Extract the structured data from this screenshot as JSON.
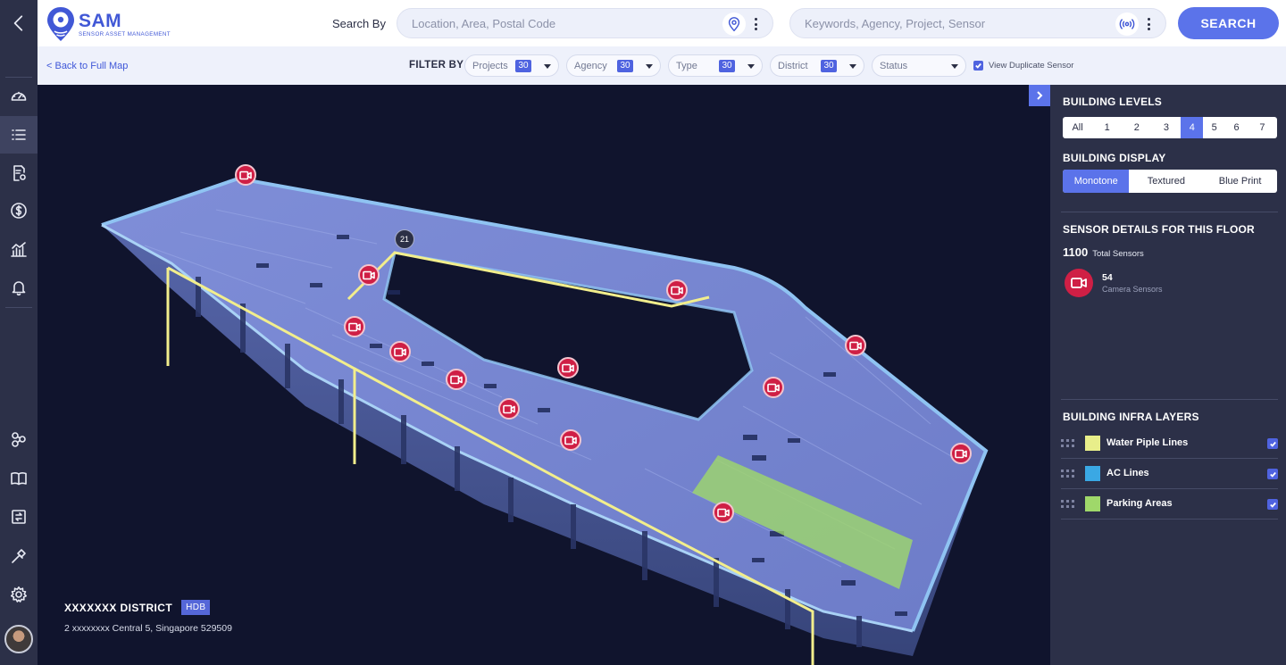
{
  "app": {
    "name": "SAM",
    "subtitle": "SENSOR ASSET MANAGEMENT"
  },
  "header": {
    "search_by_label": "Search By",
    "location_placeholder": "Location, Area, Postal Code",
    "keywords_placeholder": "Keywords, Agency, Project, Sensor",
    "search_button": "SEARCH"
  },
  "filterbar": {
    "back_link": "< Back to Full Map",
    "filter_by_label": "FILTER BY",
    "filters": [
      {
        "label": "Projects",
        "count": "30"
      },
      {
        "label": "Agency",
        "count": "30"
      },
      {
        "label": "Type",
        "count": "30"
      },
      {
        "label": "District",
        "count": "30"
      },
      {
        "label": "Status",
        "count": ""
      }
    ],
    "duplicate_label": "View Duplicate Sensor",
    "duplicate_checked": true
  },
  "map": {
    "cluster_count": "21",
    "district_name": "XXXXXXX  DISTRICT",
    "district_tag": "HDB",
    "address": "2 xxxxxxxx Central 5, Singapore 529509"
  },
  "panel": {
    "levels_title": "BUILDING LEVELS",
    "levels": [
      "All",
      "1",
      "2",
      "3",
      "4",
      "5",
      "6",
      "7"
    ],
    "selected_level": "4",
    "display_title": "BUILDING DISPLAY",
    "display_options": [
      "Monotone",
      "Textured",
      "Blue Print"
    ],
    "selected_display": "Monotone",
    "sensor_title": "SENSOR DETAILS FOR THIS FLOOR",
    "total_count": "1100",
    "total_label": "Total Sensors",
    "camera_count": "54",
    "camera_label": "Camera Sensors",
    "infra_title": "BUILDING INFRA LAYERS",
    "layers": [
      {
        "name": "Water Piple Lines",
        "color": "#e8ee8a",
        "checked": true
      },
      {
        "name": "AC Lines",
        "color": "#3aa8e4",
        "checked": true
      },
      {
        "name": "Parking Areas",
        "color": "#9fd86a",
        "checked": true
      }
    ]
  },
  "colors": {
    "accent": "#5b73ea",
    "camera_red": "#cf1f45",
    "water_line": "#f2ee8c",
    "parking": "#9fd86a"
  },
  "icons": {
    "rail": [
      "back-chevron-icon",
      "dashboard-gauge-icon",
      "list-icon",
      "document-gear-icon",
      "dollar-icon",
      "analytics-chart-icon",
      "bell-icon",
      "network-nodes-icon",
      "book-icon",
      "transfer-icon",
      "tools-icon",
      "gear-icon"
    ],
    "location_search": "location-pin-icon",
    "keyword_search": "sensor-signal-icon",
    "marker": "video-camera-icon"
  }
}
